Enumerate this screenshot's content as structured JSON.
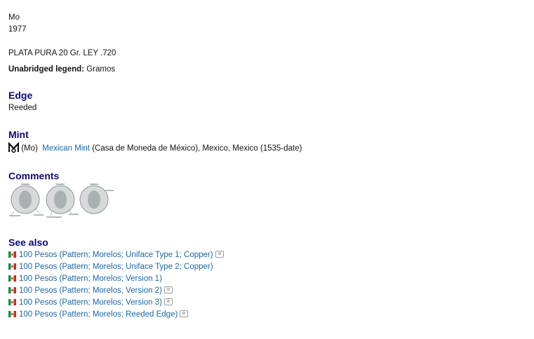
{
  "header": {
    "mint_letter": "Mo",
    "year": "1977"
  },
  "inscription": {
    "text": "PLATA PURA 20 Gr. LEY .720",
    "legend_label": "Unabridged legend:",
    "legend_value": "Gramos"
  },
  "edge": {
    "title": "Edge",
    "value": "Reeded"
  },
  "mint": {
    "title": "Mint",
    "mark": "(Mo)",
    "link_label": "Mexican Mint",
    "rest": "(Casa de Moneda de México), Mexico, Mexico (1535-date)",
    "icon": "mexico-mint-mark-icon"
  },
  "comments": {
    "title": "Comments",
    "image": "coin-varieties-comparison-image"
  },
  "see_also": {
    "title": "See also",
    "items": [
      {
        "label": "100 Pesos (Pattern; Morelos; Uniface Type 1; Copper)",
        "has_photo": true
      },
      {
        "label": "100 Pesos (Pattern; Morelos; Uniface Type 2; Copper)",
        "has_photo": false
      },
      {
        "label": "100 Pesos (Pattern; Morelos; Version 1)",
        "has_photo": false
      },
      {
        "label": "100 Pesos (Pattern; Morelos, Version 2)",
        "has_photo": true
      },
      {
        "label": "100 Pesos (Pattern; Morelos; Version 3)",
        "has_photo": true
      },
      {
        "label": "100 Pesos (Pattern; Morelos; Reeded Edge)",
        "has_photo": true
      }
    ]
  },
  "colors": {
    "heading": "#0a0a7a",
    "link": "#1a66a6",
    "text": "#111111"
  }
}
